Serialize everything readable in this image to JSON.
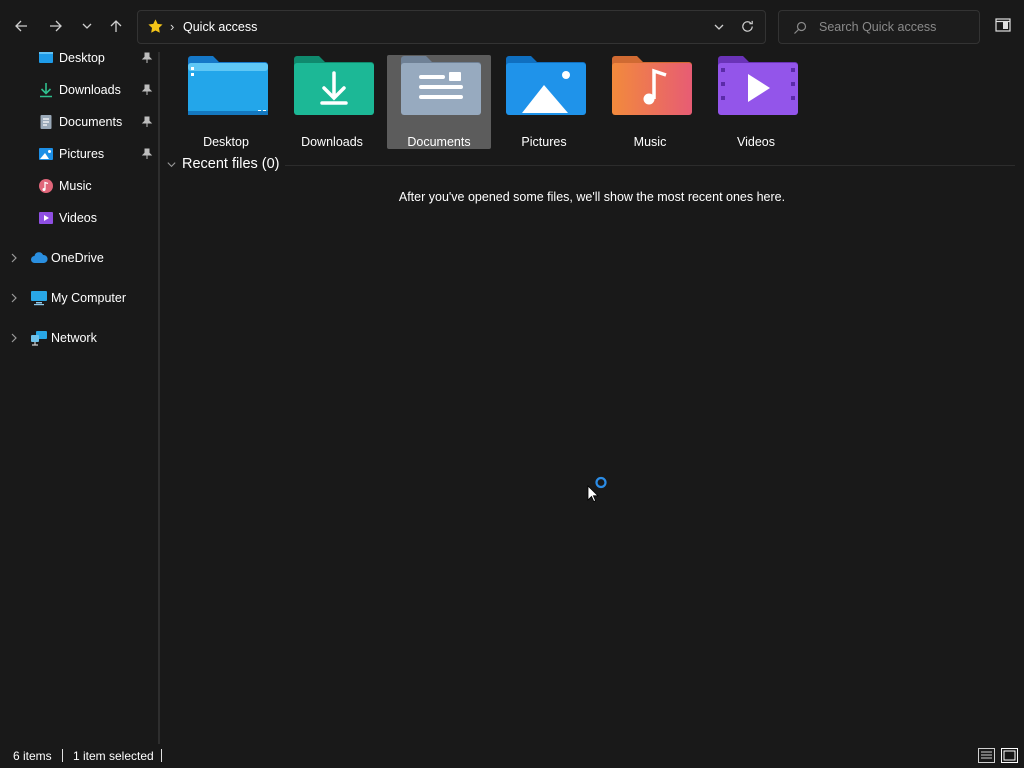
{
  "window": {
    "title": "Quick access"
  },
  "toolbar": {
    "back_icon": "arrow-left-icon",
    "forward_icon": "arrow-right-icon",
    "recent_icon": "chevron-down-icon",
    "up_icon": "arrow-up-icon"
  },
  "address": {
    "location_icon": "star-icon",
    "separator": "›",
    "path": "Quick access",
    "dropdown_icon": "chevron-down-icon",
    "refresh_icon": "refresh-icon"
  },
  "search": {
    "placeholder": "Search Quick access",
    "value": ""
  },
  "sidebar": {
    "pinned": [
      {
        "label": "Desktop",
        "icon": "desktop-icon",
        "pinned": true
      },
      {
        "label": "Downloads",
        "icon": "download-icon",
        "pinned": true
      },
      {
        "label": "Documents",
        "icon": "documents-icon",
        "pinned": true
      },
      {
        "label": "Pictures",
        "icon": "pictures-icon",
        "pinned": true
      },
      {
        "label": "Music",
        "icon": "music-icon",
        "pinned": false
      },
      {
        "label": "Videos",
        "icon": "videos-icon",
        "pinned": false
      }
    ],
    "roots": [
      {
        "label": "OneDrive",
        "icon": "cloud-icon"
      },
      {
        "label": "My Computer",
        "icon": "computer-icon"
      },
      {
        "label": "Network",
        "icon": "network-icon"
      }
    ]
  },
  "folders": [
    {
      "label": "Desktop",
      "color": "#1e9be8",
      "selected": false
    },
    {
      "label": "Downloads",
      "color": "#19b394",
      "selected": false
    },
    {
      "label": "Documents",
      "color": "#8fa3b8",
      "selected": true
    },
    {
      "label": "Pictures",
      "color": "#1d8fe6",
      "selected": false
    },
    {
      "label": "Music",
      "color": "#ee6e4c",
      "selected": false
    },
    {
      "label": "Videos",
      "color": "#8f4fe3",
      "selected": false
    }
  ],
  "recent": {
    "header": "Recent files (0)",
    "empty_message": "After you've opened some files, we'll show the most recent ones here."
  },
  "status": {
    "item_count": "6 items",
    "selection": "1 item selected"
  },
  "colors": {
    "background": "#191919",
    "accent": "#0078d4",
    "selected_tile": "#5c5c5c"
  }
}
